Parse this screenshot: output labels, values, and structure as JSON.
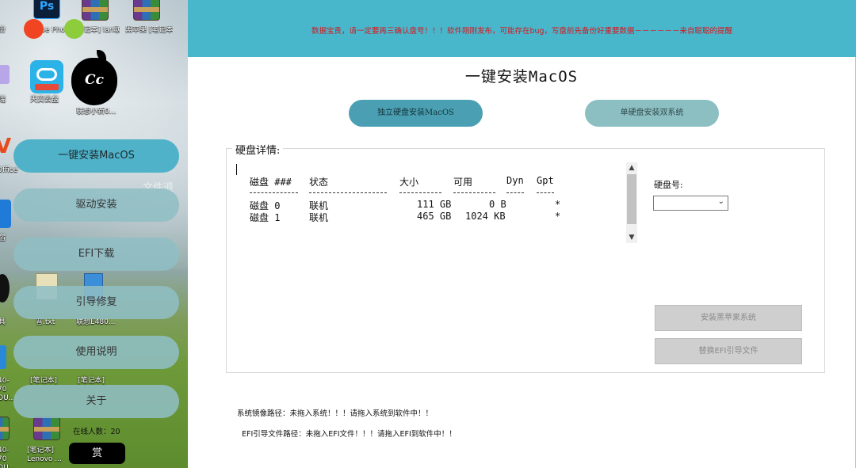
{
  "desktop": {
    "icons": [
      {
        "name": "photoshop-icon",
        "label": "Adobe Photosh..."
      },
      {
        "name": "winrar-archive-icon-1",
        "label": "[笔记本] lan联想34..."
      },
      {
        "name": "winrar-archive-icon-2",
        "label": "黑苹果 [笔记本] 10..."
      },
      {
        "name": "tianyi-cloud-icon",
        "label": "天翼云盘"
      },
      {
        "name": "apple-cc-icon",
        "label": "联想小新0..."
      },
      {
        "name": "office-icon",
        "label": "Office"
      },
      {
        "name": "text-file-icon",
        "label": "普.txt"
      },
      {
        "name": "lenovo-file-icon",
        "label": "联想E480..."
      },
      {
        "name": "winrar-archive-icon-3",
        "label": "[笔记本]"
      },
      {
        "name": "winrar-archive-icon-4",
        "label": "[笔记本]"
      },
      {
        "name": "winrar-archive-icon-5",
        "label": "[笔记本] Lenovo ..."
      }
    ],
    "left_edge_labels": [
      "份",
      "瑞",
      "Office",
      "宿",
      "具",
      "40-70 OU...",
      "40-70 OU..."
    ],
    "watermark": "文件退"
  },
  "sidebar": {
    "items": [
      {
        "label": "一键安装MacOS",
        "active": true
      },
      {
        "label": "驱动安装",
        "active": false
      },
      {
        "label": "EFI下载",
        "active": false
      },
      {
        "label": "引导修复",
        "active": false
      },
      {
        "label": "使用说明",
        "active": false
      },
      {
        "label": "关于",
        "active": false
      }
    ],
    "online_count": "在线人数：20",
    "reward_button": "赏"
  },
  "banner": {
    "text": "数据宝贵，请一定要再三确认盘号！！！软件刚刚发布，可能存在bug，写盘前先备份好重要数据－－－－－－来自聪聪的提醒",
    "color": "#d7161b",
    "background": "#48b7cc"
  },
  "main": {
    "title": "一键安装MacOS",
    "mode_buttons": {
      "single": "独立硬盘安装MacOS",
      "dual": "单硬盘安装双系统"
    },
    "disk_details": {
      "legend": "硬盘详情:",
      "headers": [
        "磁盘 ###",
        "状态",
        "大小",
        "可用",
        "Dyn",
        "Gpt"
      ],
      "rows": [
        [
          "磁盘 0",
          "联机",
          "111 GB",
          "0 B",
          "",
          "*"
        ],
        [
          "磁盘 1",
          "联机",
          "465 GB",
          "1024 KB",
          "",
          "*"
        ]
      ]
    },
    "disk_number_label": "硬盘号:",
    "disk_number_value": "",
    "install_button": "安装黑苹果系统",
    "replace_efi_button": "替换EFI引导文件",
    "system_image_path": "系统镜像路径：未拖入系统！！！请拖入系统到软件中！！",
    "efi_path": "EFI引导文件路径：未拖入EFI文件！！！请拖入EFI到软件中！！"
  }
}
